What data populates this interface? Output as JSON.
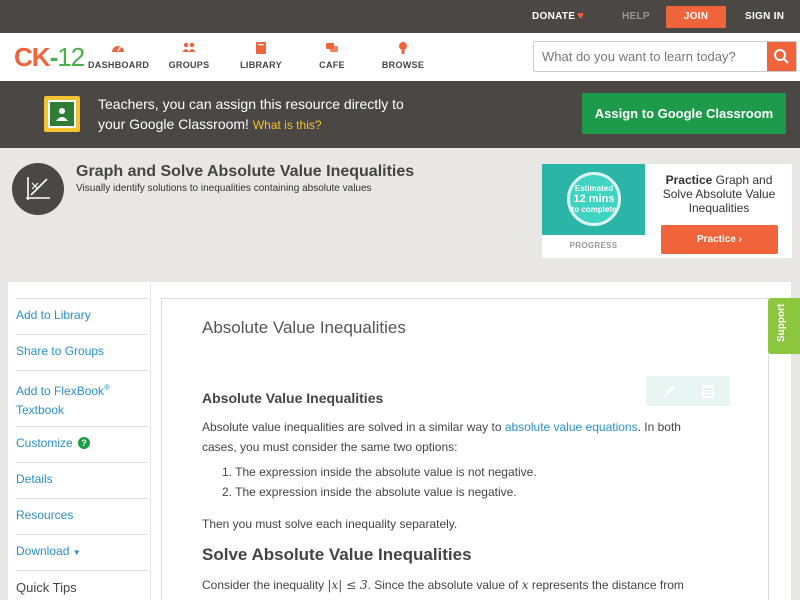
{
  "topbar": {
    "donate": "DONATE",
    "help": "HELP",
    "join": "JOIN",
    "signin": "SIGN IN"
  },
  "logo": {
    "ck": "CK",
    "dash": "-",
    "num": "12"
  },
  "nav": {
    "items": [
      {
        "label": "DASHBOARD",
        "icon": "dashboard-icon"
      },
      {
        "label": "GROUPS",
        "icon": "groups-icon"
      },
      {
        "label": "LIBRARY",
        "icon": "library-icon"
      },
      {
        "label": "CAFE",
        "icon": "cafe-icon"
      },
      {
        "label": "BROWSE",
        "icon": "browse-icon"
      }
    ],
    "search_placeholder": "What do you want to learn today?"
  },
  "banner": {
    "line1": "Teachers, you can assign this resource directly to",
    "line2": "your Google Classroom!",
    "what": "What is this?",
    "button": "Assign to Google Classroom"
  },
  "header": {
    "title": "Graph and Solve Absolute Value Inequalities",
    "subtitle": "Visually identify solutions to inequalities containing absolute values"
  },
  "practice": {
    "estimated": "Estimated",
    "mins": "12 mins",
    "to_complete": "to complete",
    "progress": "PROGRESS",
    "practice_word": "Practice",
    "text": "Graph and Solve Absolute Value Inequalities",
    "button": "Practice"
  },
  "sidebar": {
    "add_library": "Add to Library",
    "share_groups": "Share to Groups",
    "add_flexbook": "Add to FlexBook",
    "reg": "®",
    "textbook": "Textbook",
    "customize": "Customize",
    "details": "Details",
    "resources": "Resources",
    "download": "Download",
    "quick_tips": "Quick Tips"
  },
  "content": {
    "heading": "Absolute Value Inequalities",
    "subheading": "Absolute Value Inequalities",
    "p1_a": "Absolute value inequalities are solved in a similar way to ",
    "p1_link": "absolute value equations",
    "p1_b": ". In both",
    "p1_c": "cases, you must consider the same two options:",
    "item1": "The expression inside the absolute value is not negative.",
    "item2": "The expression inside the absolute value is negative.",
    "p2": "Then you must solve each inequality separately.",
    "heading2": "Solve Absolute Value Inequalities",
    "p3_a": "Consider the inequality ",
    "p3_math": "|x| ≤ 3",
    "p3_b": ". Since the absolute value of ",
    "p3_x": "x",
    "p3_c": " represents the distance from"
  },
  "support": "Support",
  "colors": {
    "accent": "#f0643c",
    "green": "#1e9a4b",
    "link": "#2a8fc9",
    "dark": "#4a4745",
    "teal": "#2bb5a9"
  }
}
